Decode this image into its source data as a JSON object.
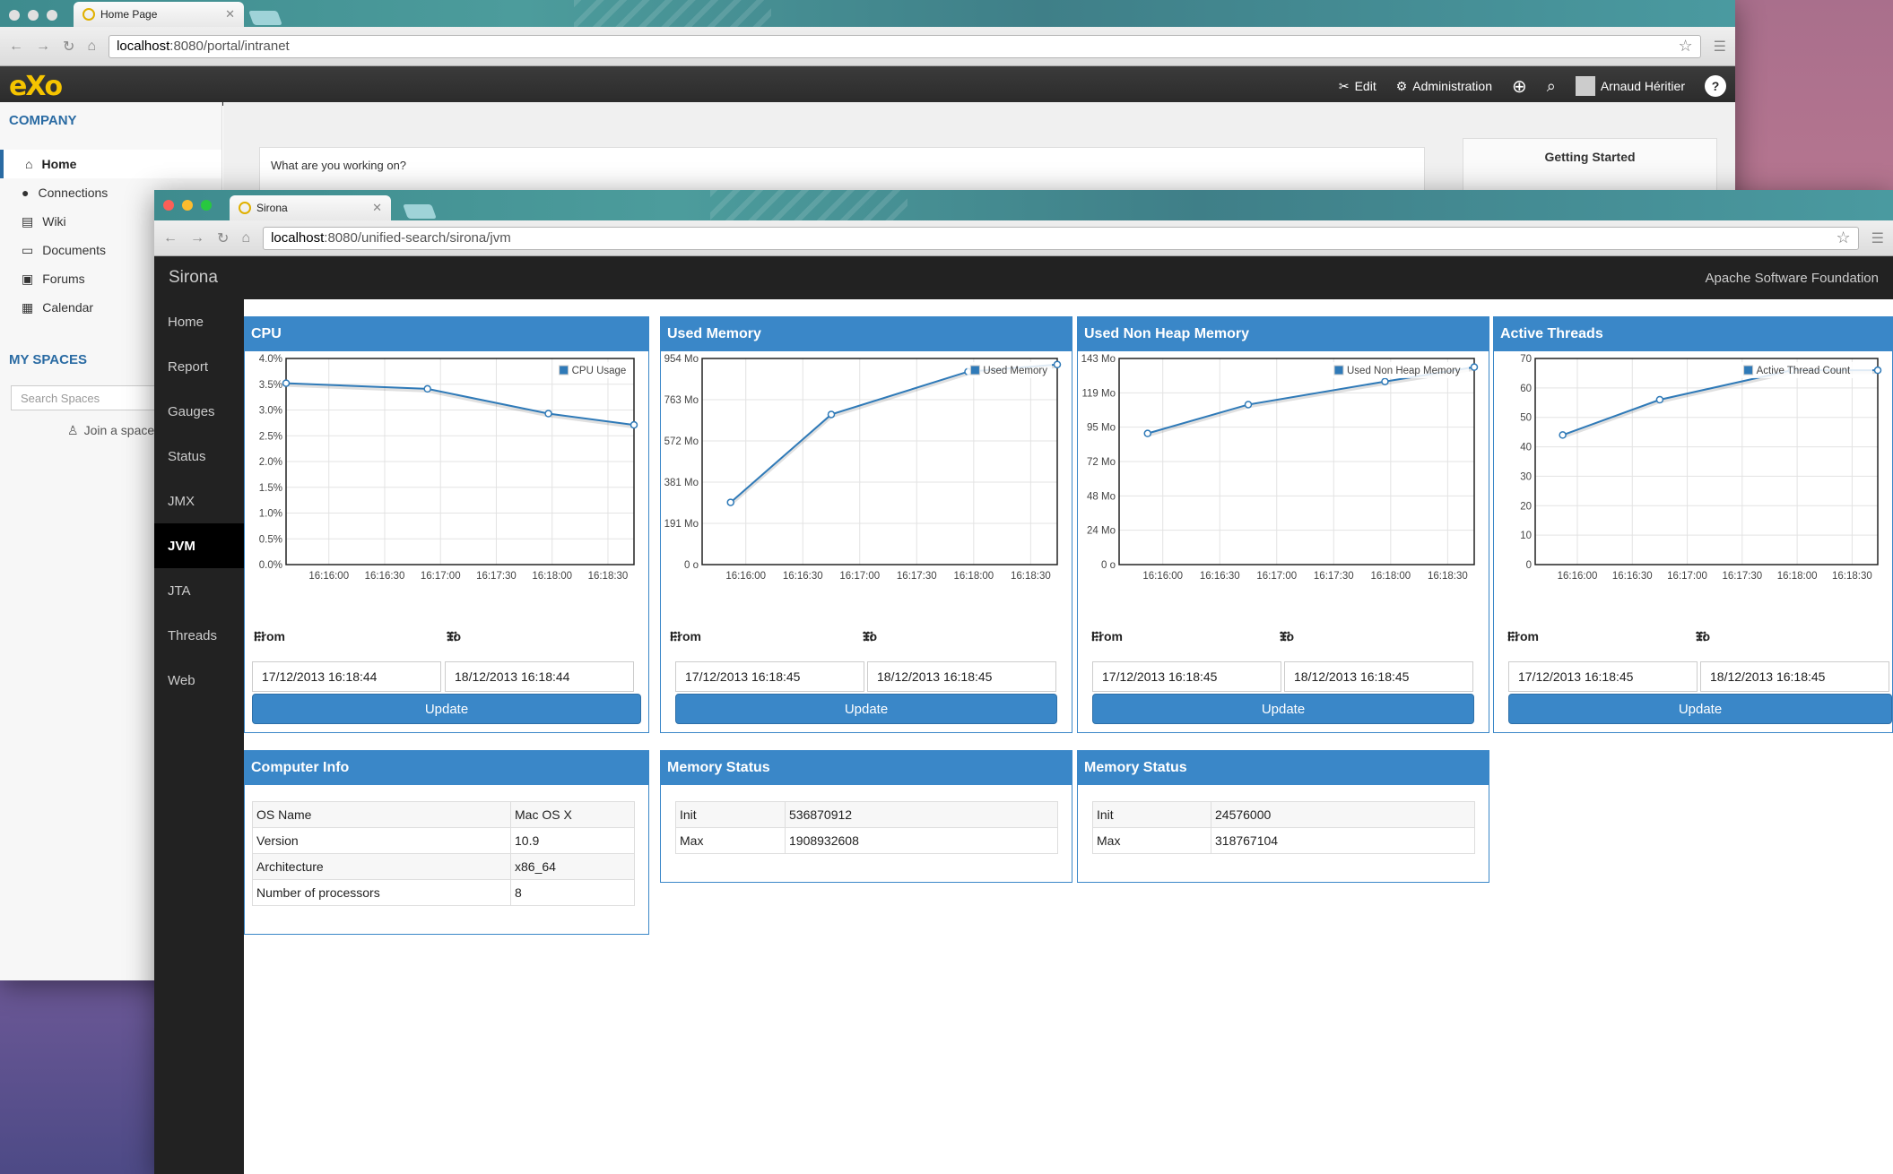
{
  "exo_window": {
    "tab_title": "Home Page",
    "url_host": "localhost",
    "url_path": ":8080/portal/intranet",
    "logo": "eXo",
    "toolbar": {
      "edit_label": "Edit",
      "administration_label": "Administration",
      "user_name": "Arnaud Héritier",
      "icons": [
        "plus-circle-icon",
        "search-icon",
        "help-icon"
      ]
    },
    "company_title": "COMPANY",
    "company_nav": [
      {
        "label": "Home",
        "icon": "home-icon"
      },
      {
        "label": "Connections",
        "icon": "user-icon"
      },
      {
        "label": "Wiki",
        "icon": "book-icon"
      },
      {
        "label": "Documents",
        "icon": "folder-icon"
      },
      {
        "label": "Forums",
        "icon": "forum-icon"
      },
      {
        "label": "Calendar",
        "icon": "calendar-icon"
      }
    ],
    "spaces_title": "MY SPACES",
    "search_spaces_placeholder": "Search Spaces",
    "join_space_label": "Join a space",
    "activity_placeholder": "What are you working on?",
    "getting_started_title": "Getting Started"
  },
  "sirona_window": {
    "tab_title": "Sirona",
    "url_host": "localhost",
    "url_path": ":8080/unified-search/sirona/jvm",
    "brand": "Sirona",
    "org": "Apache Software Foundation",
    "nav": [
      "Home",
      "Report",
      "Gauges",
      "Status",
      "JMX",
      "JVM",
      "JTA",
      "Threads",
      "Web"
    ],
    "active_nav": "JVM",
    "from_label": "From",
    "to_label": "To",
    "update_label": "Update",
    "panels": [
      {
        "title": "CPU",
        "from": "17/12/2013 16:18:44",
        "to": "18/12/2013 16:18:44"
      },
      {
        "title": "Used Memory",
        "from": "17/12/2013 16:18:45",
        "to": "18/12/2013 16:18:45"
      },
      {
        "title": "Used Non Heap Memory",
        "from": "17/12/2013 16:18:45",
        "to": "18/12/2013 16:18:45"
      },
      {
        "title": "Active Threads",
        "from": "17/12/2013 16:18:45",
        "to": "18/12/2013 16:18:45"
      }
    ],
    "computer_info": {
      "title": "Computer Info",
      "rows": [
        [
          "OS Name",
          "Mac OS X"
        ],
        [
          "Version",
          "10.9"
        ],
        [
          "Architecture",
          "x86_64"
        ],
        [
          "Number of processors",
          "8"
        ]
      ]
    },
    "memory_status_1": {
      "title": "Memory Status",
      "rows": [
        [
          "Init",
          "536870912"
        ],
        [
          "Max",
          "1908932608"
        ]
      ]
    },
    "memory_status_2": {
      "title": "Memory Status",
      "rows": [
        [
          "Init",
          "24576000"
        ],
        [
          "Max",
          "318767104"
        ]
      ]
    }
  },
  "chart_data": [
    {
      "type": "line",
      "x": [
        "16:15:37",
        "16:16:53",
        "16:17:58",
        "16:18:44"
      ],
      "series": [
        {
          "name": "CPU Usage",
          "values": [
            3.52,
            3.41,
            2.93,
            2.71
          ]
        }
      ],
      "xticks": [
        "16:16:00",
        "16:16:30",
        "16:17:00",
        "16:17:30",
        "16:18:00",
        "16:18:30"
      ],
      "yticks": [
        "0.0%",
        "0.5%",
        "1.0%",
        "1.5%",
        "2.0%",
        "2.5%",
        "3.0%",
        "3.5%",
        "4.0%"
      ],
      "ylim": [
        0,
        4
      ],
      "color": "#2f7ab8"
    },
    {
      "type": "line",
      "x": [
        "16:15:52",
        "16:16:45",
        "16:17:57",
        "16:18:44"
      ],
      "series": [
        {
          "name": "Used Memory",
          "values": [
            288,
            695,
            893,
            926
          ]
        }
      ],
      "xticks": [
        "16:16:00",
        "16:16:30",
        "16:17:00",
        "16:17:30",
        "16:18:00",
        "16:18:30"
      ],
      "yticks": [
        "0 o",
        "191 Mo",
        "381 Mo",
        "572 Mo",
        "763 Mo",
        "954 Mo"
      ],
      "ylim": [
        0,
        954
      ],
      "color": "#2f7ab8"
    },
    {
      "type": "line",
      "x": [
        "16:15:52",
        "16:16:45",
        "16:17:57",
        "16:18:44"
      ],
      "series": [
        {
          "name": "Used Non Heap Memory",
          "values": [
            91,
            111,
            127,
            137
          ]
        }
      ],
      "xticks": [
        "16:16:00",
        "16:16:30",
        "16:17:00",
        "16:17:30",
        "16:18:00",
        "16:18:30"
      ],
      "yticks": [
        "0 o",
        "24 Mo",
        "48 Mo",
        "72 Mo",
        "95 Mo",
        "119 Mo",
        "143 Mo"
      ],
      "ylim": [
        0,
        143
      ],
      "color": "#2f7ab8"
    },
    {
      "type": "line",
      "x": [
        "16:15:52",
        "16:16:45",
        "16:17:57",
        "16:18:44"
      ],
      "series": [
        {
          "name": "Active Thread Count",
          "values": [
            44,
            56,
            66,
            66
          ]
        }
      ],
      "xticks": [
        "16:16:00",
        "16:16:30",
        "16:17:00",
        "16:17:30",
        "16:18:00",
        "16:18:30"
      ],
      "yticks": [
        "0",
        "10",
        "20",
        "30",
        "40",
        "50",
        "60",
        "70"
      ],
      "ylim": [
        0,
        70
      ],
      "color": "#2f7ab8"
    }
  ]
}
